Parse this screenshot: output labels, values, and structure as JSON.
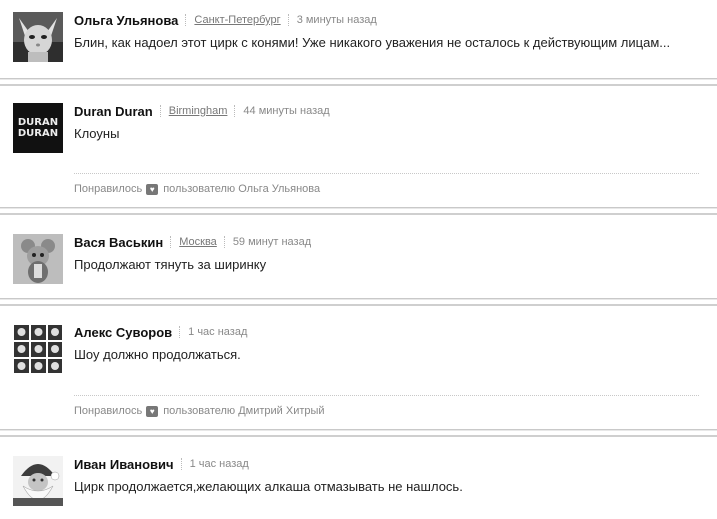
{
  "comments": [
    {
      "author": "Ольга Ульянова",
      "city": "Санкт-Петербург",
      "time": "3 минуты назад",
      "text": "Блин, как надоел этот цирк с конями! Уже никакого уважения не осталось к действующим лицам...",
      "avatar_icon": "sphynx-cat-photo"
    },
    {
      "author": "Duran Duran",
      "city": "Birmingham",
      "time": "44 минуты назад",
      "text": "Клоуны",
      "avatar_icon": "duran-duran-logo",
      "avatar_text": [
        "DURAN",
        "DURAN"
      ],
      "likes": {
        "label": "Понравилось",
        "by": "пользователю Ольга Ульянова"
      }
    },
    {
      "author": "Вася Васькин",
      "city": "Москва",
      "time": "59 минут назад",
      "text": "Продолжают тянуть за ширинку",
      "avatar_icon": "mouse-figure-photo"
    },
    {
      "author": "Алекс Суворов",
      "time": "1 час назад",
      "text": "Шоу должно продолжаться.",
      "avatar_icon": "portrait-grid-photo",
      "likes": {
        "label": "Понравилось",
        "by": "пользователю Дмитрий Хитрый"
      }
    },
    {
      "author": "Иван Иванович",
      "time": "1 час назад",
      "text": "Цирк продолжается,желающих алкаша отмазывать не нашлось.",
      "avatar_icon": "santa-claus-photo"
    }
  ],
  "colors": {
    "text": "#222222",
    "muted": "#888888",
    "divider": "#cfcfcf",
    "heart": "#777777"
  }
}
